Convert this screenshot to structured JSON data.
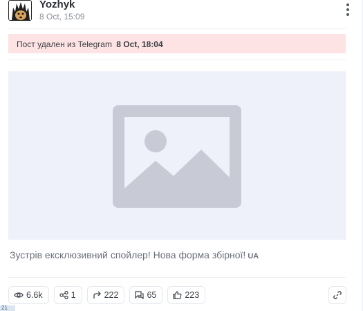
{
  "post": {
    "author": "Yozhyk",
    "time": "8 Oct, 15:09",
    "deleted_prefix": "Пост удален из Telegram",
    "deleted_date": "8 Oct, 18:04",
    "caption": "Зустрів ексклюзивний спойлер! Нова форма збірної!",
    "caption_flag": "UA"
  },
  "stats": {
    "views": "6.6k",
    "shares": "1",
    "forwards": "222",
    "comments": "65",
    "reactions": "223"
  },
  "icons": {
    "menu": "more-vertical-icon",
    "views": "eye-icon",
    "shares": "share-icon",
    "forwards": "forward-icon",
    "comments": "comments-icon",
    "reactions": "thumbs-up-icon",
    "link": "link-icon",
    "media": "image-placeholder-icon"
  },
  "colors": {
    "deleted_banner": "#fde3e3",
    "media_bg": "#eef0fa",
    "placeholder": "#c8cbd6"
  },
  "corner_badge": "21"
}
